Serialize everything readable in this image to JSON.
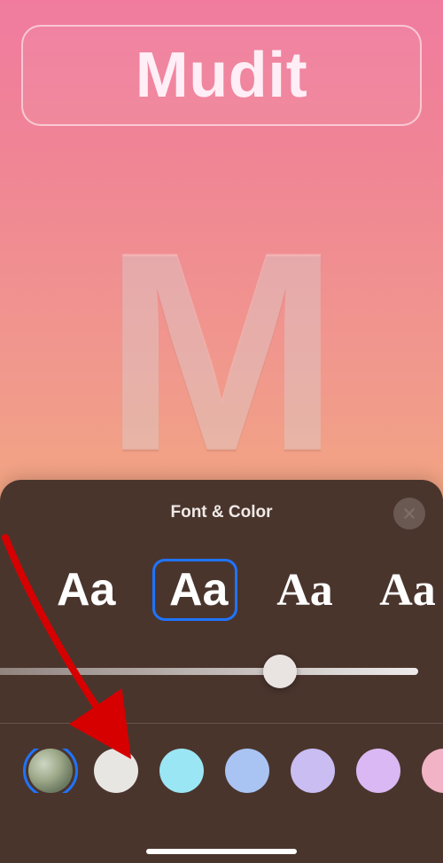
{
  "name_field": {
    "value": "Mudit"
  },
  "monogram": {
    "letter": "M"
  },
  "sheet": {
    "title": "Font & Color",
    "fonts": [
      {
        "sample": "Aa",
        "style": "sans-bold",
        "selected": false
      },
      {
        "sample": "Aa",
        "style": "sans-bold",
        "selected": true
      },
      {
        "sample": "Aa",
        "style": "serif",
        "selected": false
      },
      {
        "sample": "Aa",
        "style": "serif2",
        "selected": false
      }
    ],
    "slider": {
      "value": 0.67,
      "min": 0,
      "max": 1
    },
    "colors": [
      {
        "name": "gradient",
        "css": "radial-gradient(circle at 35% 35%, #cdd6c3 0%, #9ea98a 40%, #6e7c63 70%, #55624f 100%)",
        "selected": true
      },
      {
        "name": "white",
        "css": "#e8e6e3",
        "selected": false
      },
      {
        "name": "sky",
        "css": "#9be6f4",
        "selected": false
      },
      {
        "name": "periwinkle",
        "css": "#a9c3f3",
        "selected": false
      },
      {
        "name": "lavender",
        "css": "#c9bdf2",
        "selected": false
      },
      {
        "name": "lilac",
        "css": "#d9b8f3",
        "selected": false
      },
      {
        "name": "pink",
        "css": "#f2b3c7",
        "selected": false
      }
    ]
  },
  "annotation": {
    "points_to": "colors.0"
  }
}
